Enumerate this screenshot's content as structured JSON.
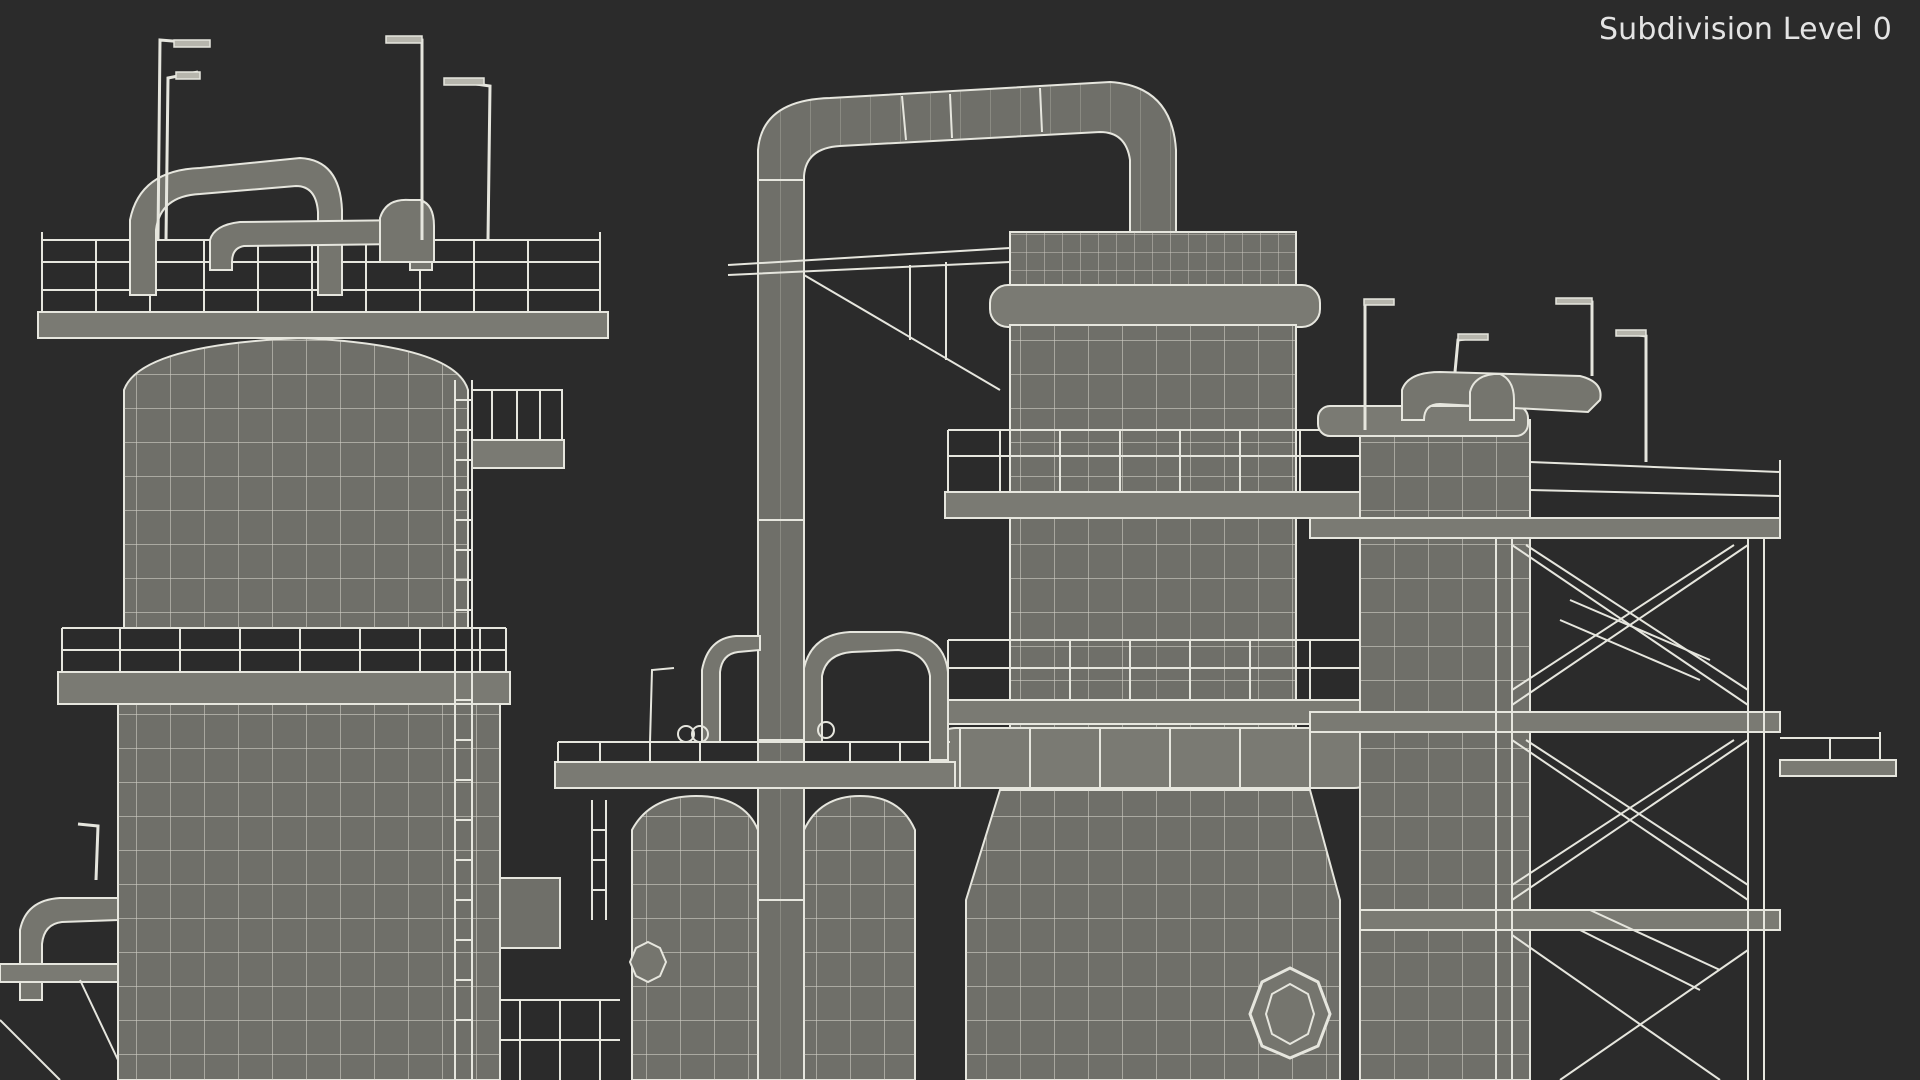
{
  "viewport": {
    "overlay_label": "Subdivision Level 0",
    "background_color": "#2b2b2b",
    "model_fill_color": "#6f6f69",
    "wire_color": "#e6e6de"
  }
}
